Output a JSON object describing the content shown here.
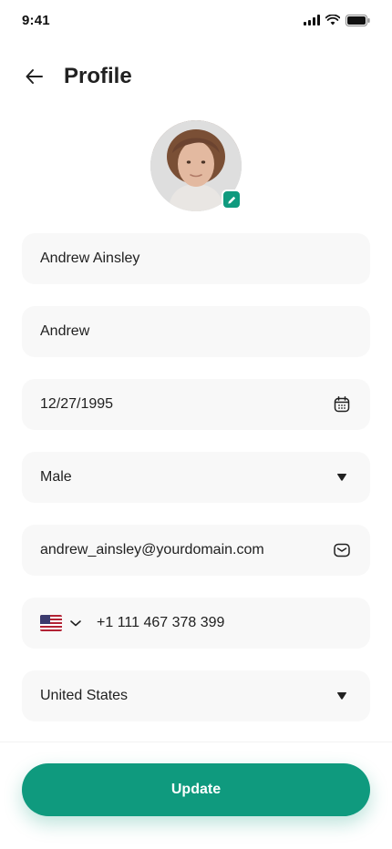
{
  "status_bar": {
    "time": "9:41"
  },
  "header": {
    "title": "Profile"
  },
  "form": {
    "full_name": "Andrew Ainsley",
    "nickname": "Andrew",
    "birth_date": "12/27/1995",
    "gender": "Male",
    "email": "andrew_ainsley@yourdomain.com",
    "phone": "+1 111 467 378 399",
    "country": "United States"
  },
  "actions": {
    "update_label": "Update"
  },
  "colors": {
    "accent": "#0f9a7e",
    "field_bg": "#f8f8f8",
    "text": "#212121"
  },
  "icons": [
    "arrow-left-icon",
    "edit-pencil-icon",
    "calendar-icon",
    "caret-down-icon",
    "mail-icon",
    "us-flag-icon",
    "chevron-down-icon"
  ]
}
